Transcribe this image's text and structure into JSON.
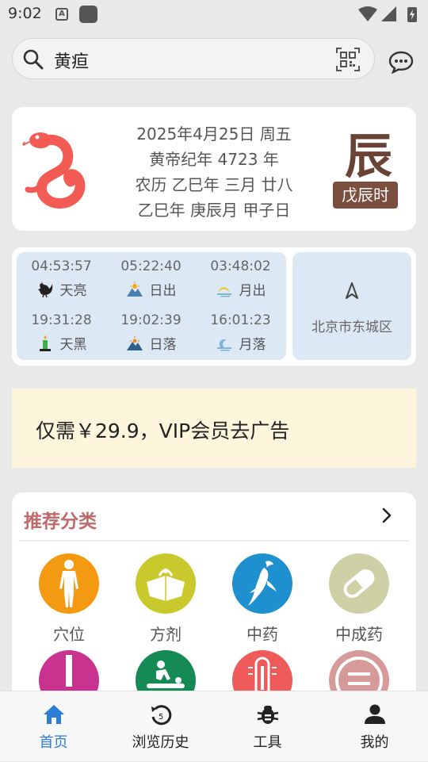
{
  "status": {
    "time": "9:02"
  },
  "search": {
    "query": "黄疸"
  },
  "almanac": {
    "gregorian": "2025年4月25日 周五",
    "huangdi": "黄帝纪年 4723 年",
    "lunar": "农历 乙巳年 三月 廿八",
    "ganzhi": "乙巳年 庚辰月 甲子日",
    "zodiac_char": "辰",
    "hour": "戊辰时",
    "snake_color": "#f25c54"
  },
  "sun": {
    "cells": [
      {
        "time": "04:53:57",
        "label": "天亮",
        "icon": "rooster-icon"
      },
      {
        "time": "05:22:40",
        "label": "日出",
        "icon": "sunrise-icon"
      },
      {
        "time": "03:48:02",
        "label": "月出",
        "icon": "moonrise-icon"
      },
      {
        "time": "19:31:28",
        "label": "天黑",
        "icon": "candle-icon"
      },
      {
        "time": "19:02:39",
        "label": "日落",
        "icon": "sunset-icon"
      },
      {
        "time": "16:01:23",
        "label": "月落",
        "icon": "moonset-icon"
      }
    ],
    "location": "北京市东城区"
  },
  "vip": {
    "text": "仅需￥29.9，VIP会员去广告"
  },
  "categories": {
    "title": "推荐分类",
    "items": [
      {
        "label": "穴位",
        "color": "#f39a12",
        "icon": "body-icon"
      },
      {
        "label": "方剂",
        "color": "#c9c92e",
        "icon": "herb-pack-icon"
      },
      {
        "label": "中药",
        "color": "#1e8fcf",
        "icon": "ginseng-icon"
      },
      {
        "label": "中成药",
        "color": "#cdd0a4",
        "icon": "pill-icon"
      },
      {
        "color": "#c9328f",
        "icon": "bar-icon"
      },
      {
        "color": "#168a55",
        "icon": "massage-icon"
      },
      {
        "color": "#ef5a5a",
        "icon": "thermometer-icon"
      },
      {
        "color": "#d79a9a",
        "icon": "equal-icon"
      }
    ]
  },
  "nav": {
    "items": [
      {
        "label": "首页",
        "icon": "home-icon",
        "active": true
      },
      {
        "label": "浏览历史",
        "icon": "history-icon"
      },
      {
        "label": "工具",
        "icon": "bug-icon"
      },
      {
        "label": "我的",
        "icon": "person-icon"
      }
    ],
    "active_color": "#2b7dd6"
  }
}
